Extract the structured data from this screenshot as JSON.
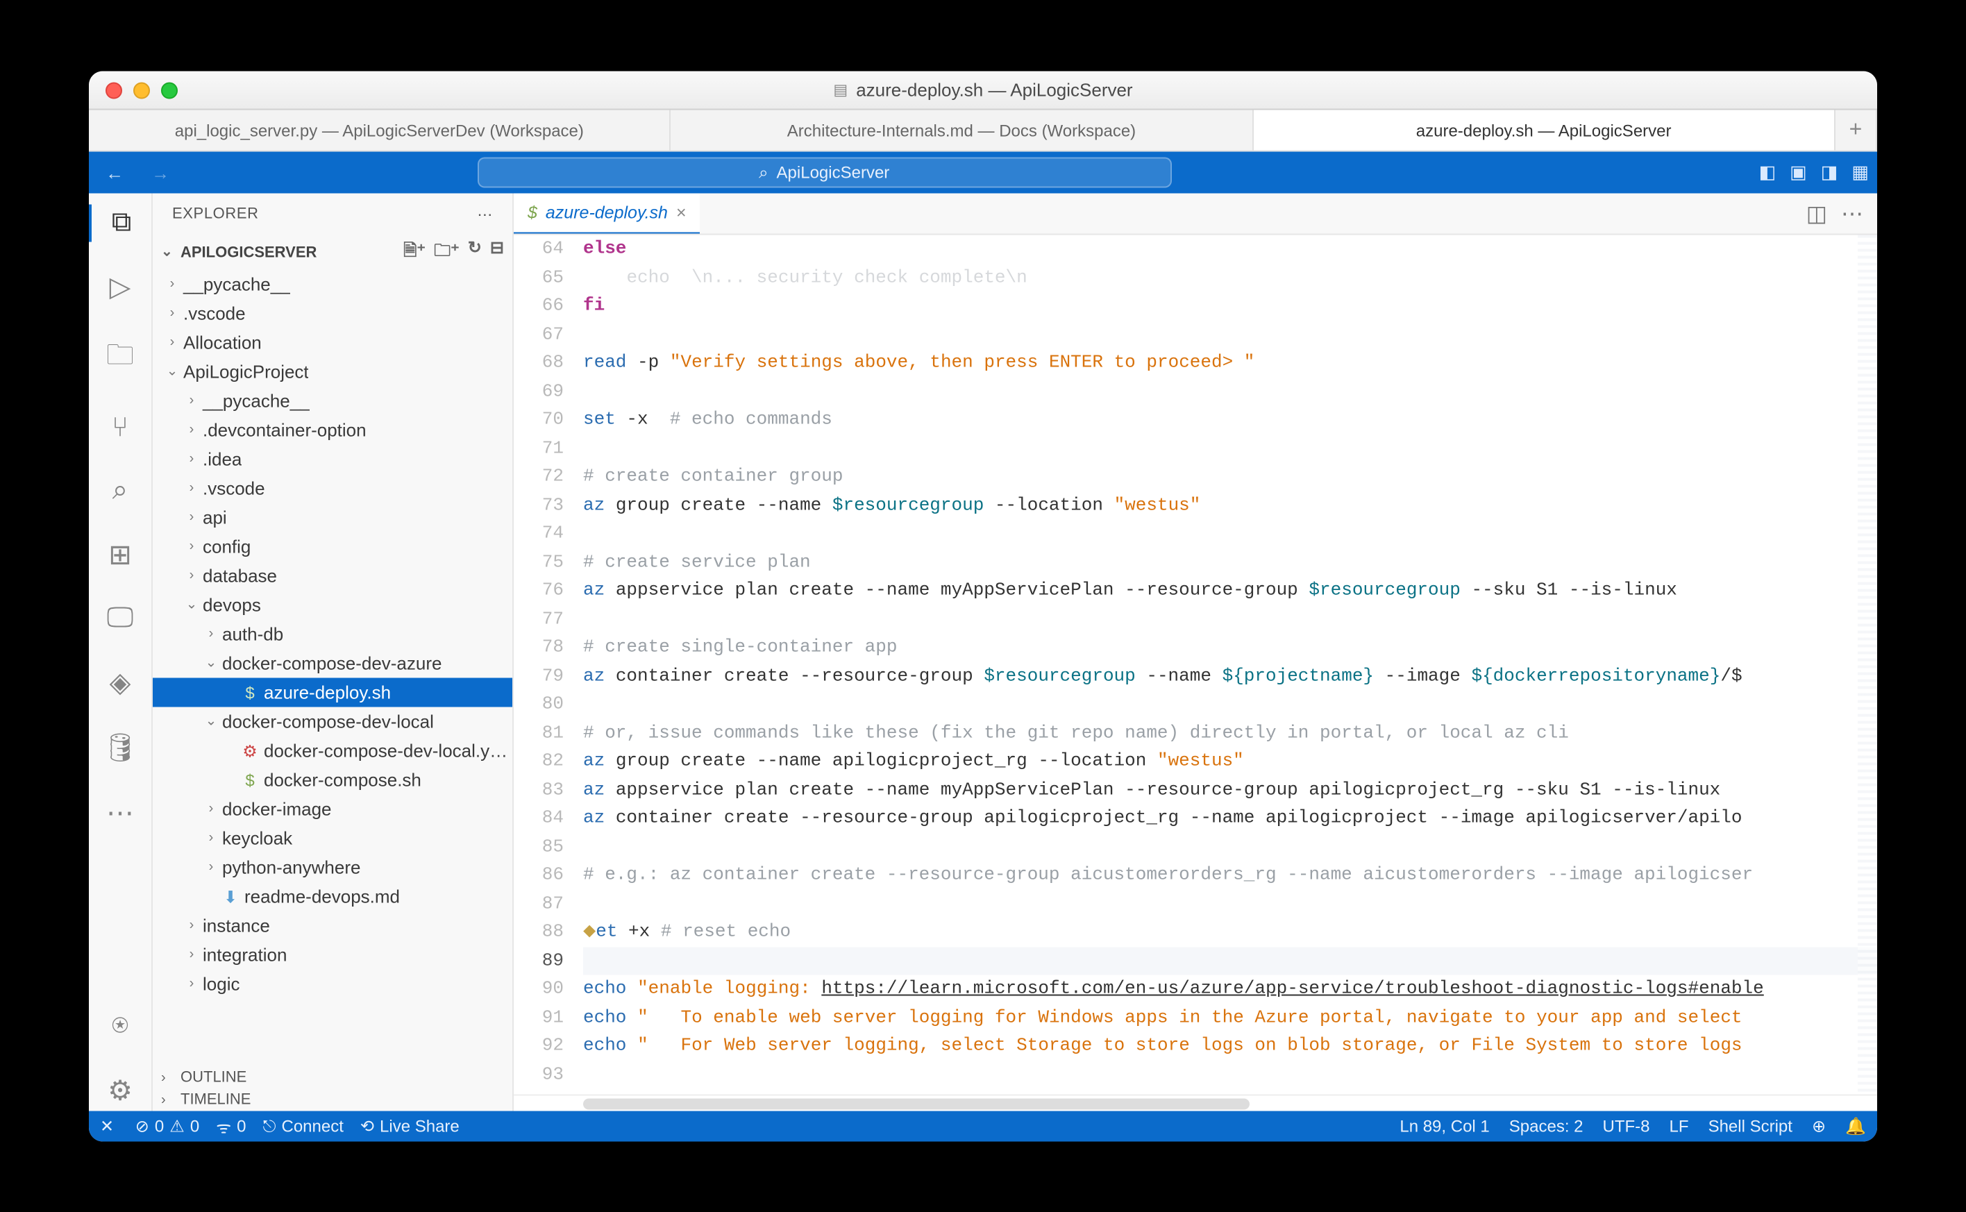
{
  "window_title": "azure-deploy.sh — ApiLogicServer",
  "window_tabs": [
    "api_logic_server.py — ApiLogicServerDev (Workspace)",
    "Architecture-Internals.md — Docs (Workspace)",
    "azure-deploy.sh — ApiLogicServer"
  ],
  "active_window_tab": 2,
  "search_placeholder": "ApiLogicServer",
  "explorer_label": "EXPLORER",
  "project_label": "APILOGICSERVER",
  "outline_label": "OUTLINE",
  "timeline_label": "TIMELINE",
  "tree": [
    {
      "d": 0,
      "c": "›",
      "i": "",
      "l": "__pycache__"
    },
    {
      "d": 0,
      "c": "›",
      "i": "",
      "l": ".vscode"
    },
    {
      "d": 0,
      "c": "›",
      "i": "",
      "l": "Allocation"
    },
    {
      "d": 0,
      "c": "⌄",
      "i": "",
      "l": "ApiLogicProject"
    },
    {
      "d": 1,
      "c": "›",
      "i": "",
      "l": "__pycache__"
    },
    {
      "d": 1,
      "c": "›",
      "i": "",
      "l": ".devcontainer-option"
    },
    {
      "d": 1,
      "c": "›",
      "i": "",
      "l": ".idea"
    },
    {
      "d": 1,
      "c": "›",
      "i": "",
      "l": ".vscode"
    },
    {
      "d": 1,
      "c": "›",
      "i": "",
      "l": "api"
    },
    {
      "d": 1,
      "c": "›",
      "i": "",
      "l": "config"
    },
    {
      "d": 1,
      "c": "›",
      "i": "",
      "l": "database"
    },
    {
      "d": 1,
      "c": "⌄",
      "i": "",
      "l": "devops"
    },
    {
      "d": 2,
      "c": "›",
      "i": "",
      "l": "auth-db"
    },
    {
      "d": 2,
      "c": "⌄",
      "i": "",
      "l": "docker-compose-dev-azure"
    },
    {
      "d": 3,
      "c": "",
      "i": "$",
      "cls": "shicon",
      "l": "azure-deploy.sh",
      "sel": true
    },
    {
      "d": 2,
      "c": "⌄",
      "i": "",
      "l": "docker-compose-dev-local"
    },
    {
      "d": 3,
      "c": "",
      "i": "⚙",
      "cls": "yicon",
      "l": "docker-compose-dev-local.y…"
    },
    {
      "d": 3,
      "c": "",
      "i": "$",
      "cls": "shicon",
      "l": "docker-compose.sh"
    },
    {
      "d": 2,
      "c": "›",
      "i": "",
      "l": "docker-image"
    },
    {
      "d": 2,
      "c": "›",
      "i": "",
      "l": "keycloak"
    },
    {
      "d": 2,
      "c": "›",
      "i": "",
      "l": "python-anywhere"
    },
    {
      "d": 2,
      "c": "",
      "i": "⬇",
      "cls": "mdicon",
      "l": "readme-devops.md"
    },
    {
      "d": 1,
      "c": "›",
      "i": "",
      "l": "instance"
    },
    {
      "d": 1,
      "c": "›",
      "i": "",
      "l": "integration"
    },
    {
      "d": 1,
      "c": "›",
      "i": "",
      "l": "logic"
    }
  ],
  "tab_label": "azure-deploy.sh",
  "tab_icon": "$",
  "code": [
    {
      "n": 64,
      "h": "<span class='kw'>else</span>"
    },
    {
      "n": 65,
      "h": "    <span class='cmt'>echo  \\n... security check complete\\n</span>",
      "faded": true
    },
    {
      "n": 66,
      "h": "<span class='kw'>fi</span>"
    },
    {
      "n": 67,
      "h": ""
    },
    {
      "n": 68,
      "h": "<span class='cmd'>read</span> -p <span class='str'>\"Verify settings above, then press ENTER to proceed&gt; \"</span>"
    },
    {
      "n": 69,
      "h": ""
    },
    {
      "n": 70,
      "h": "<span class='cmd'>set</span> -x  <span class='cmt'># echo commands</span>"
    },
    {
      "n": 71,
      "h": ""
    },
    {
      "n": 72,
      "h": "<span class='cmt'># create container group</span>"
    },
    {
      "n": 73,
      "h": "<span class='cmd'>az</span> group create --name <span class='var'>$resourcegroup</span> --location <span class='str'>\"westus\"</span>"
    },
    {
      "n": 74,
      "h": ""
    },
    {
      "n": 75,
      "h": "<span class='cmt'># create service plan</span>"
    },
    {
      "n": 76,
      "h": "<span class='cmd'>az</span> appservice plan create --name myAppServicePlan --resource-group <span class='var'>$resourcegroup</span> --sku S1 --is-linux"
    },
    {
      "n": 77,
      "h": ""
    },
    {
      "n": 78,
      "h": "<span class='cmt'># create single-container app</span>"
    },
    {
      "n": 79,
      "h": "<span class='cmd'>az</span> container create --resource-group <span class='var'>$resourcegroup</span> --name <span class='var'>${projectname}</span> --image <span class='var'>${dockerrepositoryname}</span>/$"
    },
    {
      "n": 80,
      "h": ""
    },
    {
      "n": 81,
      "h": "<span class='cmt'># or, issue commands like these (fix the git repo name) directly in portal, or local az cli</span>"
    },
    {
      "n": 82,
      "h": "<span class='cmd'>az</span> group create --name apilogicproject_rg --location <span class='str'>\"westus\"</span>"
    },
    {
      "n": 83,
      "h": "<span class='cmd'>az</span> appservice plan create --name myAppServicePlan --resource-group apilogicproject_rg --sku S1 --is-linux"
    },
    {
      "n": 84,
      "h": "<span class='cmd'>az</span> container create --resource-group apilogicproject_rg --name apilogicproject --image apilogicserver/apilo"
    },
    {
      "n": 85,
      "h": ""
    },
    {
      "n": 86,
      "h": "<span class='cmt'># e.g.: az container create --resource-group aicustomerorders_rg --name aicustomerorders --image apilogicser</span>"
    },
    {
      "n": 87,
      "h": ""
    },
    {
      "n": 88,
      "h": "<span style='color:#c7a245'>⬥</span><span class='cmd'>et</span> +x <span class='cmt'># reset echo</span>"
    },
    {
      "n": 89,
      "h": "",
      "cur": true
    },
    {
      "n": 90,
      "h": "<span class='cmd'>echo</span> <span class='str'>\"enable logging: </span><span class='url'>https://learn.microsoft.com/en-us/azure/app-service/troubleshoot-diagnostic-logs#enable</span>"
    },
    {
      "n": 91,
      "h": "<span class='cmd'>echo</span> <span class='str'>\"   To enable web server logging for Windows apps in the Azure portal, navigate to your app and select </span>"
    },
    {
      "n": 92,
      "h": "<span class='cmd'>echo</span> <span class='str'>\"   For Web server logging, select Storage to store logs on blob storage, or File System to store logs </span>"
    },
    {
      "n": 93,
      "h": ""
    }
  ],
  "status": {
    "remote": "⎘",
    "errors": "0",
    "warnings": "0",
    "ports": "0",
    "connect": "Connect",
    "liveshare": "Live Share",
    "cursor": "Ln 89, Col 1",
    "spaces": "Spaces: 2",
    "encoding": "UTF-8",
    "eol": "LF",
    "lang": "Shell Script"
  }
}
